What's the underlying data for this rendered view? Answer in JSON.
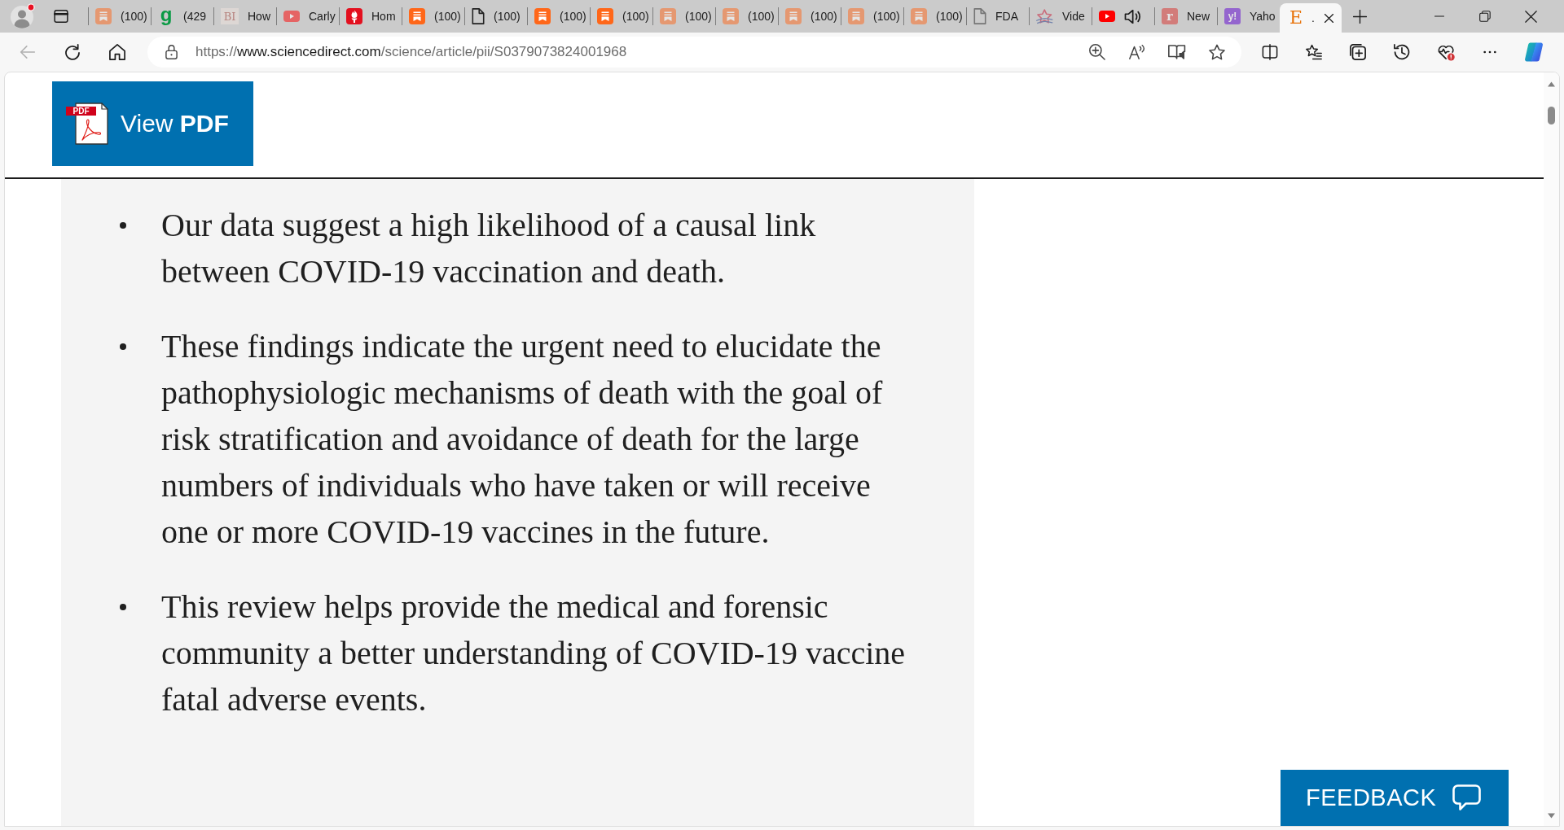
{
  "browser": {
    "tabs": [
      {
        "kind": "bookmark",
        "sleeping": true,
        "playing_audio": false,
        "label": "(100)",
        "selected": false
      },
      {
        "kind": "glyph",
        "logo_text": "g",
        "sleeping": false,
        "playing_audio": false,
        "label": "(429",
        "selected": false
      },
      {
        "kind": "monogram",
        "logo_text": "BI",
        "sleeping": true,
        "playing_audio": false,
        "label": "How",
        "selected": false
      },
      {
        "kind": "video",
        "sleeping": true,
        "playing_audio": false,
        "label": "Carly",
        "selected": false
      },
      {
        "kind": "flame",
        "sleeping": false,
        "playing_audio": false,
        "label": "Hom",
        "selected": false
      },
      {
        "kind": "bookmark",
        "sleeping": false,
        "playing_audio": false,
        "label": "(100)",
        "selected": false
      },
      {
        "kind": "file",
        "sleeping": false,
        "playing_audio": false,
        "label": "(100)",
        "selected": false
      },
      {
        "kind": "bookmark",
        "sleeping": false,
        "playing_audio": false,
        "label": "(100)",
        "selected": false
      },
      {
        "kind": "bookmark",
        "sleeping": false,
        "playing_audio": false,
        "label": "(100)",
        "selected": false
      },
      {
        "kind": "bookmark",
        "sleeping": true,
        "playing_audio": false,
        "label": "(100)",
        "selected": false
      },
      {
        "kind": "bookmark",
        "sleeping": true,
        "playing_audio": false,
        "label": "(100)",
        "selected": false
      },
      {
        "kind": "bookmark",
        "sleeping": true,
        "playing_audio": false,
        "label": "(100)",
        "selected": false
      },
      {
        "kind": "bookmark",
        "sleeping": true,
        "playing_audio": false,
        "label": "(100)",
        "selected": false
      },
      {
        "kind": "bookmark",
        "sleeping": true,
        "playing_audio": false,
        "label": "(100)",
        "selected": false
      },
      {
        "kind": "file",
        "sleeping": true,
        "playing_audio": false,
        "label": "FDA",
        "selected": false
      },
      {
        "kind": "star",
        "sleeping": true,
        "playing_audio": false,
        "label": "Vide",
        "selected": false
      },
      {
        "kind": "video",
        "sleeping": false,
        "playing_audio": true,
        "selected": false
      },
      {
        "kind": "redtile",
        "logo_text": "r",
        "sleeping": true,
        "playing_audio": false,
        "label": "New",
        "selected": false
      },
      {
        "kind": "purpletile",
        "logo_text": "y!",
        "sleeping": true,
        "playing_audio": false,
        "label": "Yaho",
        "selected": false
      },
      {
        "kind": "initial",
        "logo_text": "E",
        "sleeping": false,
        "playing_audio": false,
        "label": ".",
        "selected": true
      }
    ],
    "back_button": {
      "disabled": true
    },
    "address_bar": {
      "url": {
        "scheme": "https://",
        "host": "www.sciencedirect.com",
        "path": "/science/article/pii/S0379073824001968"
      }
    }
  },
  "article": {
    "view_pdf_button": {
      "icon_badge": "PDF",
      "label": "View **PDF**"
    },
    "highlights": [
      "Our data suggest a high likelihood of a causal link between COVID-19 vaccination and death.",
      "These findings indicate the urgent need to elucidate the pathophysiologic mechanisms of death with the goal of risk stratification and avoidance of death for the large numbers of individuals who have taken or will receive one or more COVID-19 vaccines in the future.",
      "This review helps provide the medical and forensic community a better understanding of COVID-19 vaccine fatal adverse events."
    ],
    "feedback_button": {
      "label": "FEEDBACK"
    }
  }
}
